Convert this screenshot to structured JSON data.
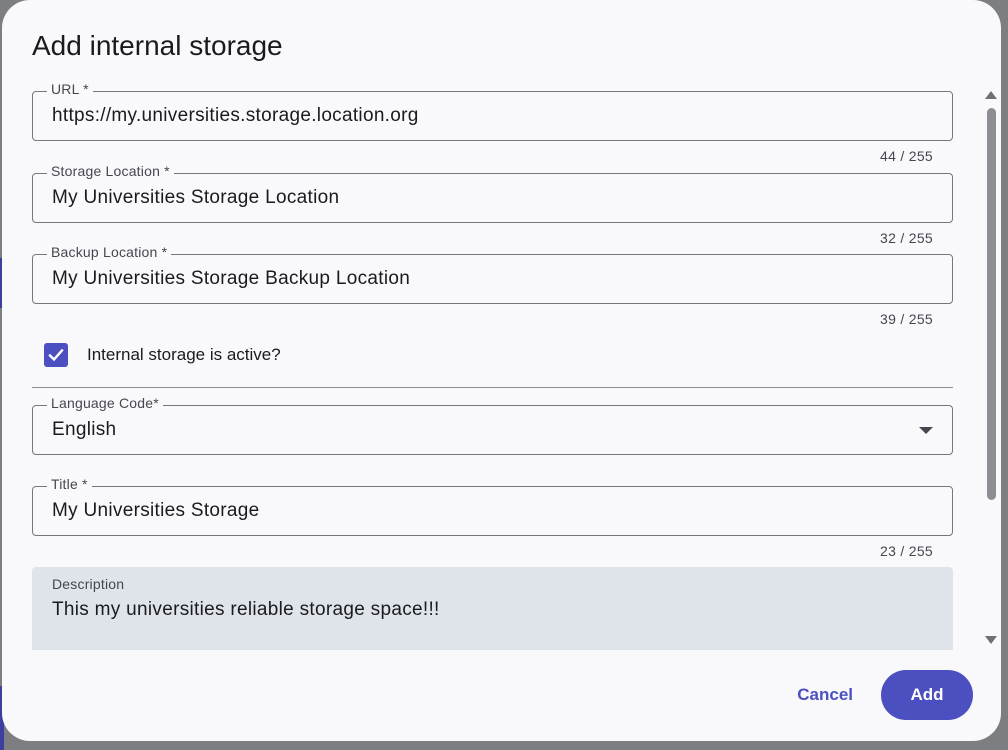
{
  "dialog": {
    "title": "Add internal storage",
    "fields": {
      "url": {
        "label": "URL *",
        "value": "https://my.universities.storage.location.org",
        "counter": "44 / 255"
      },
      "storage_location": {
        "label": "Storage Location *",
        "value": "My Universities Storage Location",
        "counter": "32 / 255"
      },
      "backup_location": {
        "label": "Backup Location *",
        "value": "My Universities Storage Backup Location",
        "counter": "39 / 255"
      },
      "active_checkbox": {
        "label": "Internal storage is active?",
        "checked": true
      },
      "language_code": {
        "label": "Language Code*",
        "value": "English"
      },
      "title": {
        "label": "Title *",
        "value": "My Universities Storage",
        "counter": "23 / 255"
      },
      "description": {
        "label": "Description",
        "value": "This my universities reliable storage space!!!"
      }
    },
    "actions": {
      "cancel_label": "Cancel",
      "add_label": "Add"
    }
  },
  "icons": {
    "checkbox": "check-icon",
    "select": "caret-down-icon",
    "scroll_up": "arrow-up-icon",
    "scroll_down": "arrow-down-icon"
  },
  "colors": {
    "primary": "#4b4fbf",
    "surface": "#f9f9fc",
    "filled_field": "#dfe3ea",
    "text": "#1b1b1f"
  }
}
